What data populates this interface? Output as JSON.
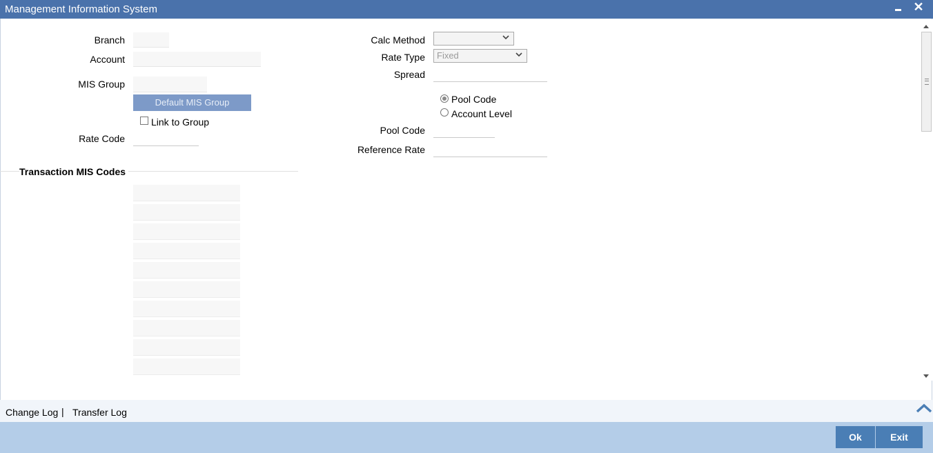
{
  "window": {
    "title": "Management Information System"
  },
  "form": {
    "branch_label": "Branch",
    "account_label": "Account",
    "mis_group_label": "MIS Group",
    "default_mis_group_button": "Default MIS Group",
    "link_to_group_label": "Link to Group",
    "rate_code_label": "Rate Code",
    "calc_method_label": "Calc Method",
    "calc_method_value": "",
    "rate_type_label": "Rate Type",
    "rate_type_value": "Fixed",
    "spread_label": "Spread",
    "pool_code_radio": "Pool Code",
    "account_level_radio": "Account Level",
    "pool_code_label": "Pool Code",
    "reference_rate_label": "Reference Rate"
  },
  "section": {
    "title": "Transaction MIS Codes"
  },
  "footer": {
    "change_log": "Change Log",
    "separator": "|",
    "transfer_log": "Transfer Log",
    "ok_button": "Ok",
    "exit_button": "Exit"
  },
  "icons": {
    "minimize": "minimize-icon",
    "close": "close-icon",
    "dropdown": "chevron-down-icon",
    "scroll_up": "scroll-up-icon",
    "scroll_down": "scroll-down-icon",
    "expand": "chevron-up-icon"
  },
  "colors": {
    "titlebar": "#4a72ab",
    "button_primary": "#4a7eb5",
    "button_disabled": "#7d9ac8",
    "footer_band": "#b4cde8"
  }
}
